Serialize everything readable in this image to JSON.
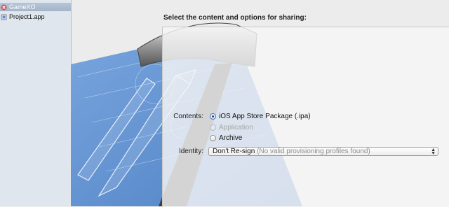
{
  "left_list": {
    "items": [
      {
        "label": "GameXO",
        "selected": true,
        "icon": "red-x-app-icon"
      },
      {
        "label": "Project1.app",
        "selected": false,
        "icon": "app-bundle-icon"
      }
    ]
  },
  "sheet": {
    "title": "Select the content and options for sharing:",
    "contents_label": "Contents:",
    "options": [
      {
        "label": "iOS App Store Package (.ipa)",
        "selected": true,
        "enabled": true
      },
      {
        "label": "Application",
        "selected": false,
        "enabled": false
      },
      {
        "label": "Archive",
        "selected": false,
        "enabled": true
      }
    ],
    "identity_label": "Identity:",
    "identity_value": "Don't Re-sign",
    "identity_hint": "(No valid provisioning profiles found)"
  },
  "colors": {
    "blueprint": "#5b8fd0",
    "selection": "#a9b9cd",
    "accent": "#3f6db3"
  }
}
